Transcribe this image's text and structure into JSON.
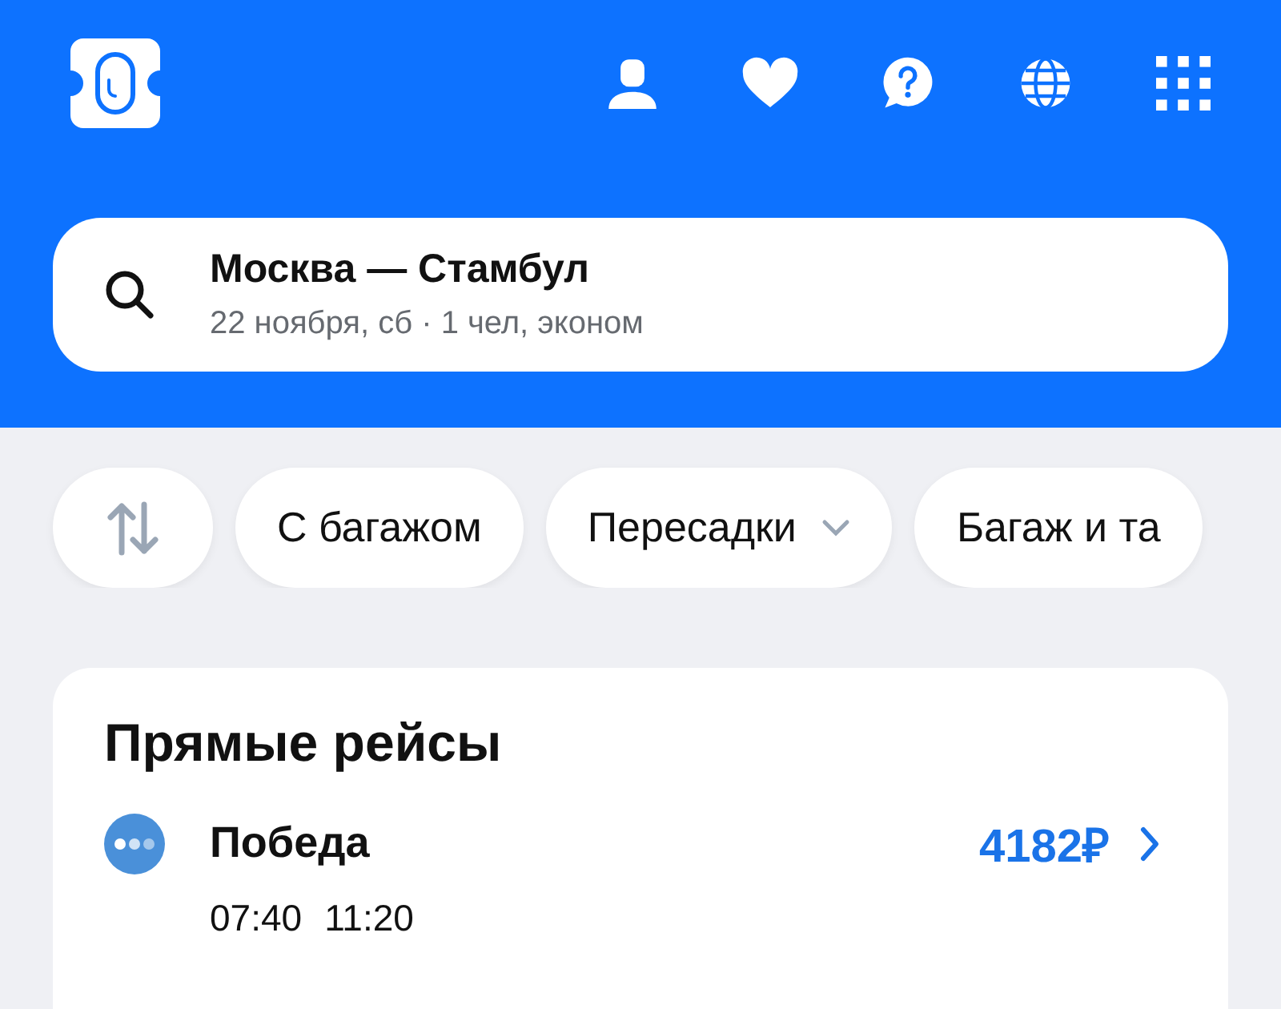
{
  "header": {
    "icons": [
      {
        "kind": "profile"
      },
      {
        "kind": "favorites"
      },
      {
        "kind": "help"
      },
      {
        "kind": "language"
      },
      {
        "kind": "apps"
      }
    ]
  },
  "search": {
    "route": "Москва — Стамбул",
    "details": "22 ноября, сб · 1 чел, эконом"
  },
  "filters": [
    {
      "kind": "sort"
    },
    {
      "kind": "chip",
      "label": "С багажом"
    },
    {
      "kind": "dropdown",
      "label": "Пересадки"
    },
    {
      "kind": "chip",
      "label": "Багаж и та"
    }
  ],
  "section": {
    "title": "Прямые рейсы",
    "flights": [
      {
        "airline": "Победа",
        "price": "4182₽",
        "departure": "07:40",
        "arrival": "11:20"
      }
    ]
  }
}
